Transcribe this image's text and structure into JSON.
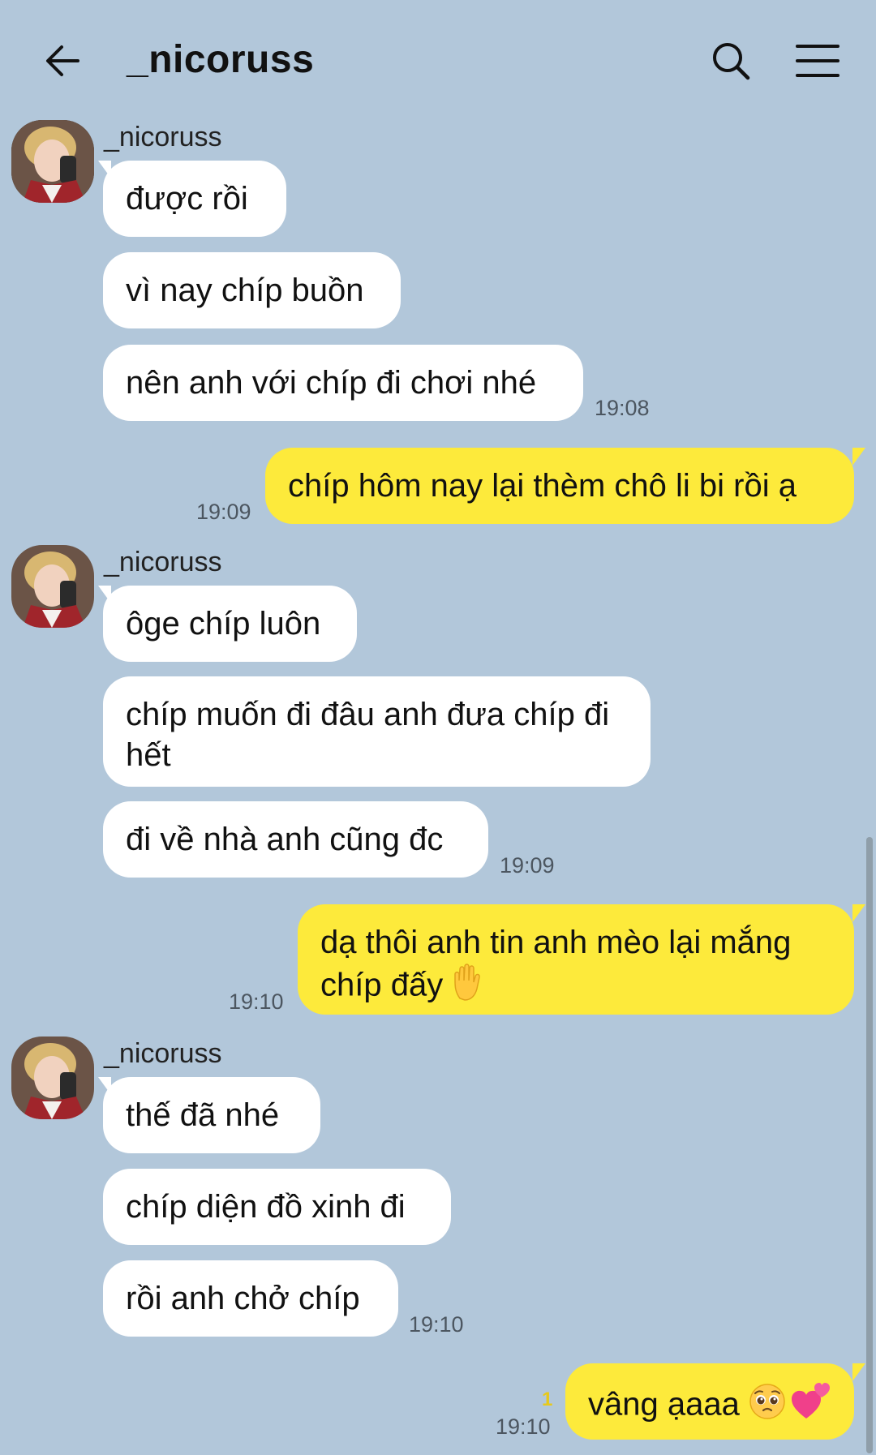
{
  "header": {
    "title": "_nicoruss",
    "back_icon": "arrow-left-icon",
    "search_icon": "search-icon",
    "menu_icon": "hamburger-menu-icon"
  },
  "colors": {
    "background": "#b2c7da",
    "incoming_bubble": "#ffffff",
    "outgoing_bubble": "#fdea3b",
    "unread_indicator": "#e7c91a"
  },
  "messages": {
    "g1": {
      "sender": "_nicoruss",
      "m1": "được rồi",
      "m2": "vì nay chíp buồn",
      "m3": "nên anh với chíp đi chơi nhé",
      "time": "19:08"
    },
    "o1": {
      "text": "chíp hôm nay lại thèm chô li bi rồi ạ",
      "time": "19:09"
    },
    "g2": {
      "sender": "_nicoruss",
      "m1": "ôge chíp luôn",
      "m2": "chíp muốn đi đâu anh đưa chíp đi hết",
      "m3": "đi về nhà anh cũng đc",
      "time": "19:09"
    },
    "o2": {
      "text": "dạ thôi anh tin anh mèo lại mắng chíp đấy",
      "emoji": "raised-hand-emoji",
      "time": "19:10"
    },
    "g3": {
      "sender": "_nicoruss",
      "m1": "thế đã nhé",
      "m2": "chíp diện đồ xinh đi",
      "m3": "rồi anh chở chíp",
      "time": "19:10"
    },
    "o3": {
      "text": "vâng ạaaa",
      "emojis": [
        "pleading-face-emoji",
        "two-hearts-emoji"
      ],
      "unread": "1",
      "time": "19:10"
    }
  }
}
